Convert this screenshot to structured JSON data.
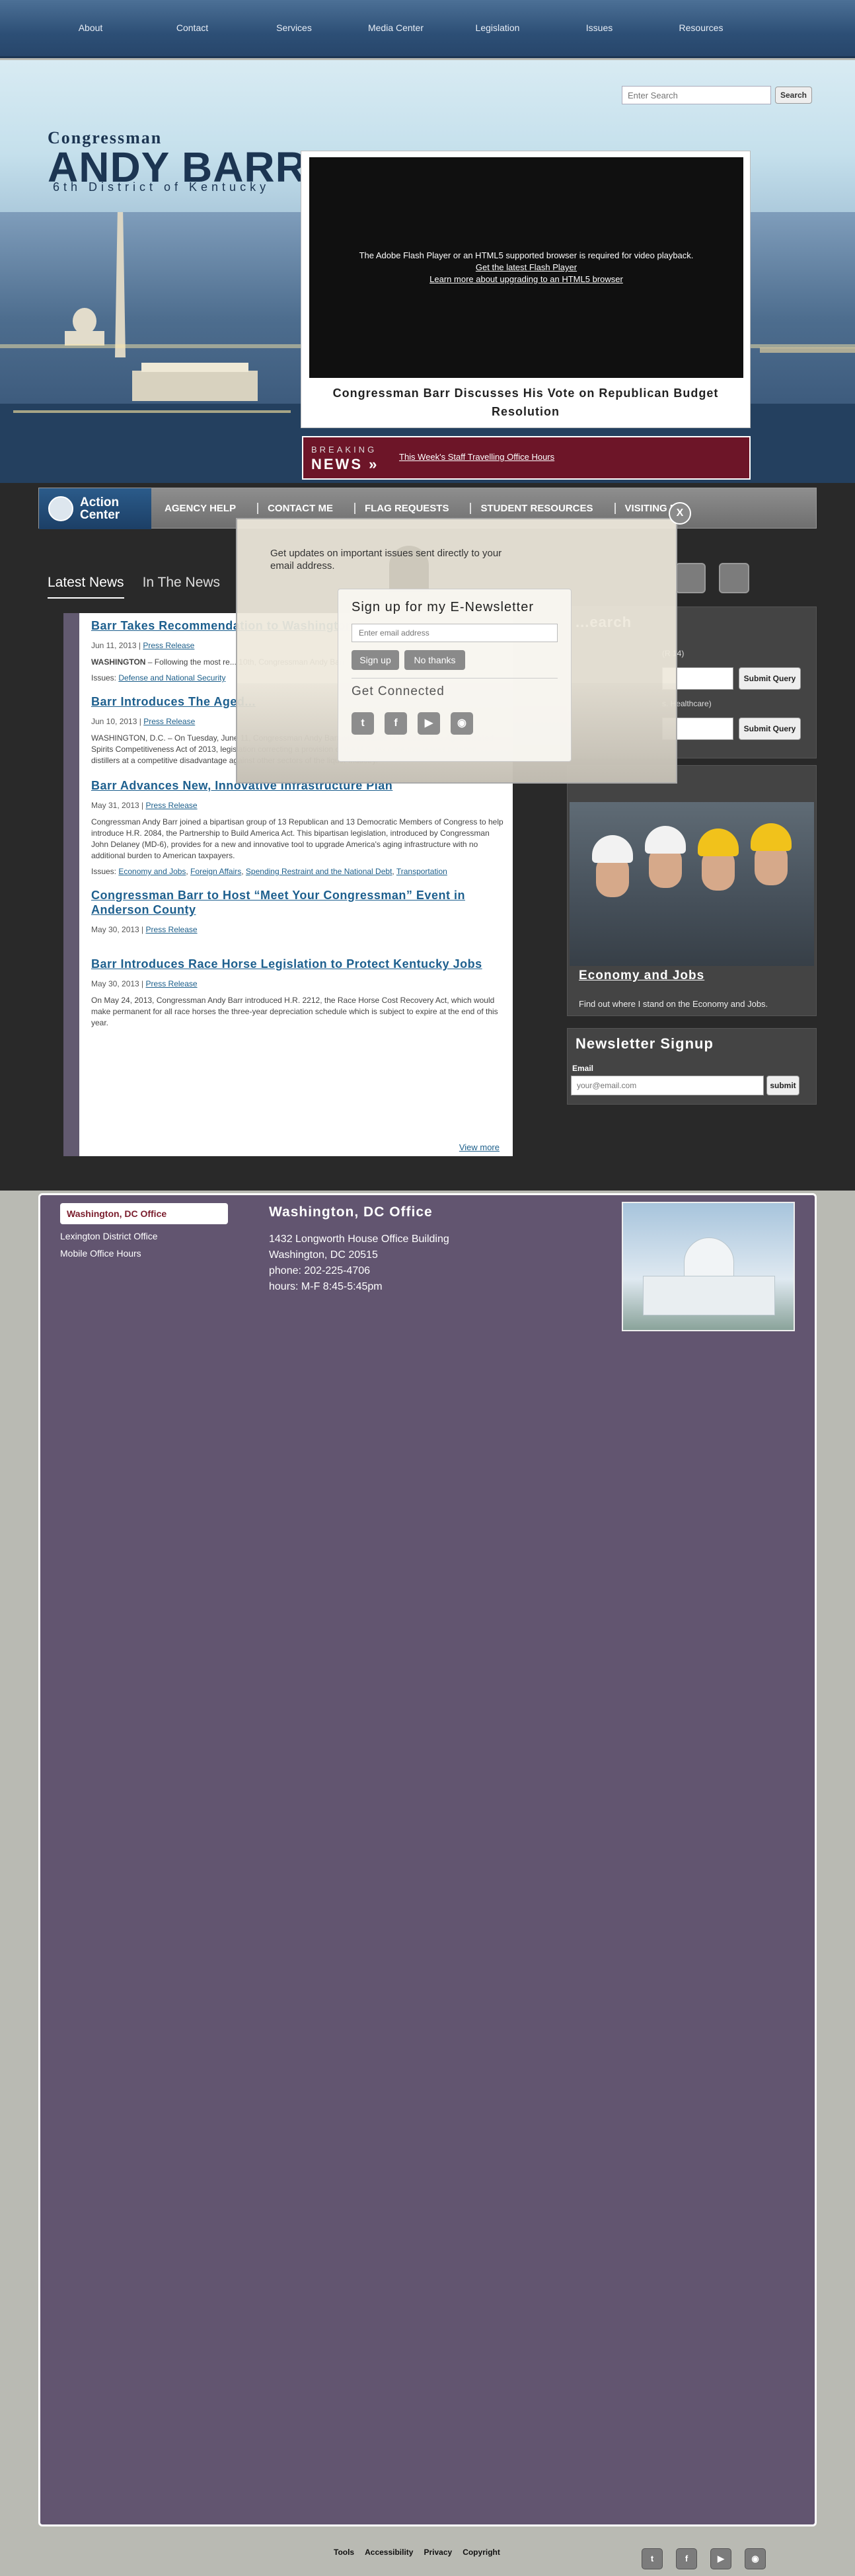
{
  "topnav": {
    "items": [
      "About",
      "Contact",
      "Services",
      "Media Center",
      "Legislation",
      "Issues",
      "Resources"
    ]
  },
  "logo": {
    "line1": "Congressman",
    "line2": "ANDY BARR",
    "line3": "6th District of Kentucky"
  },
  "search": {
    "placeholder": "Enter Search",
    "button": "Search"
  },
  "video": {
    "message": "The Adobe Flash Player or an HTML5 supported browser is required for video playback.",
    "link1": "Get the latest Flash Player",
    "link2": "Learn more about upgrading to an HTML5 browser",
    "caption": "Congressman Barr Discusses His Vote on Republican Budget Resolution"
  },
  "breaking": {
    "label_small": "BREAKING",
    "label_big": "NEWS",
    "arrows": "»",
    "link": "This Week's Staff Travelling Office Hours"
  },
  "action": {
    "title": "Action Center",
    "items": [
      "AGENCY HELP",
      "CONTACT ME",
      "FLAG REQUESTS",
      "STUDENT RESOURCES",
      "VISITING D.C."
    ]
  },
  "tabs": [
    "Latest News",
    "In The News"
  ],
  "news": [
    {
      "title": "Barr Takes Recommendation to Washington",
      "date": "Jun 11, 2013",
      "category": "Press Release",
      "body_bold": "WASHINGTON",
      "body": " – Following the most re... 10th, Congressman Andy Barr released...",
      "issues_label": "Issues:",
      "issues": [
        "Defense and National Security"
      ]
    },
    {
      "title": "Barr Introduces The Aged...",
      "date": "Jun 10, 2013",
      "category": "Press Release",
      "body_bold": "",
      "body": "WASHINGTON, D.C. – On Tuesday, June 11, Congressman Andy Barr will introduce H.R. 2312, The Aged Distilled Spirits Competitiveness Act of 2013, legislation correcting a provision of the U.S. tax code that leaves bourbon distillers at a competitive disadvantage against other sectors of the liquor industry.",
      "issues_label": "",
      "issues": []
    },
    {
      "title": "Barr Advances New, Innovative Infrastructure Plan",
      "date": "May 31, 2013",
      "category": "Press Release",
      "body_bold": "",
      "body": "Congressman Andy Barr joined a bipartisan group of 13 Republican and 13 Democratic Members of Congress to help introduce H.R. 2084, the Partnership to Build America Act. This bipartisan legislation, introduced by Congressman John Delaney (MD-6), provides for a new and innovative tool to upgrade America's aging infrastructure with no additional burden to American taxpayers.",
      "issues_label": "Issues:",
      "issues": [
        "Economy and Jobs",
        "Foreign Affairs",
        "Spending Restraint and the National Debt",
        "Transportation"
      ]
    },
    {
      "title": "Congressman Barr to Host “Meet Your Congressman” Event in Anderson County",
      "date": "May 30, 2013",
      "category": "Press Release",
      "body_bold": "",
      "body": "",
      "issues_label": "",
      "issues": []
    },
    {
      "title": "Barr Introduces Race Horse Legislation to Protect Kentucky Jobs",
      "date": "May 30, 2013",
      "category": "Press Release",
      "body_bold": "",
      "body": "On May 24, 2013, Congressman Andy Barr introduced H.R. 2212, the Race Horse Cost Recovery Act, which would make permanent for all race horses the three-year depreciation schedule which is subject to expire at the end of this year.",
      "issues_label": "",
      "issues": []
    }
  ],
  "view_more": "View more",
  "right": {
    "search_title": "...earch",
    "search_hint1": "(R 14)",
    "search_hint2": "s. Healthcare)",
    "submit": "Submit Query",
    "econ_title": "Economy and Jobs",
    "econ_sub": "Find out where I stand on the Economy and Jobs.",
    "newsletter_title": "Newsletter Signup",
    "email_label": "Email",
    "email_placeholder": "your@email.com",
    "email_submit": "submit"
  },
  "modal": {
    "lead": "Get updates on important issues sent directly to your email address.",
    "title": "Sign up for my E-Newsletter",
    "email_placeholder": "Enter email address",
    "signup": "Sign up",
    "nothanks": "No thanks",
    "connected": "Get Connected",
    "close": "X"
  },
  "office": {
    "tabs": [
      "Washington, DC Office",
      "Lexington District Office",
      "Mobile Office Hours"
    ],
    "title": "Washington, DC Office",
    "lines": [
      "1432 Longworth House Office Building",
      "Washington, DC 20515",
      "phone: 202-225-4706",
      "hours: M-F 8:45-5:45pm"
    ]
  },
  "footer": {
    "links": [
      "Tools",
      "Accessibility",
      "Privacy",
      "Copyright"
    ]
  },
  "colors": {
    "accent": "#625570",
    "breaking": "#6d1528",
    "link": "#1b5e8a"
  }
}
